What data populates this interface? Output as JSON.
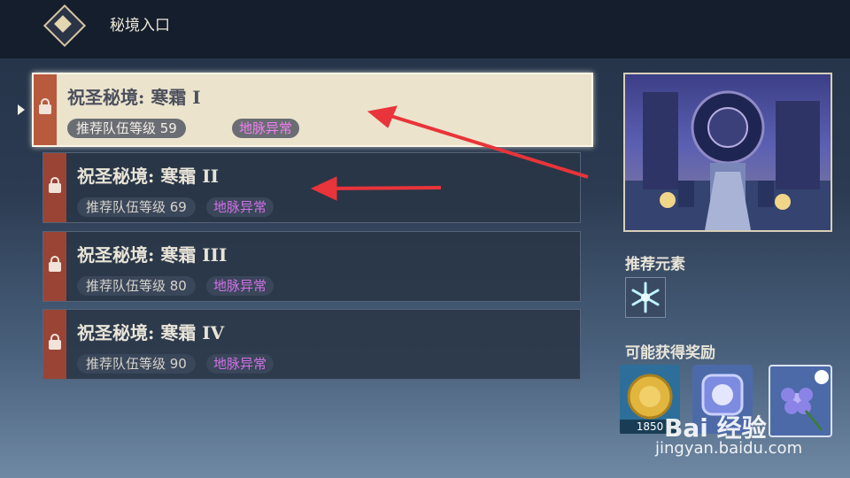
{
  "header": {
    "title": "秘境入口"
  },
  "domains": [
    {
      "name": "祝圣秘境: 寒霜 I",
      "level": "推荐队伍等级 59",
      "tag": "地脉异常",
      "selected": true
    },
    {
      "name": "祝圣秘境: 寒霜 II",
      "level": "推荐队伍等级 69",
      "tag": "地脉异常",
      "selected": false
    },
    {
      "name": "祝圣秘境: 寒霜 III",
      "level": "推荐队伍等级 80",
      "tag": "地脉异常",
      "selected": false
    },
    {
      "name": "祝圣秘境: 寒霜 IV",
      "level": "推荐队伍等级 90",
      "tag": "地脉异常",
      "selected": false
    }
  ],
  "sidebar": {
    "recommended_label": "推荐元素",
    "recommended_element_icon": "cryo-element-icon",
    "rewards_label": "可能获得奖励",
    "rewards": [
      {
        "icon": "mora-icon",
        "count": "1850"
      },
      {
        "icon": "artifact-exp-icon",
        "count": ""
      },
      {
        "icon": "flower-artifact-icon",
        "count": ""
      }
    ]
  },
  "watermark": {
    "brand": "Bai 经验",
    "url": "jingyan.baidu.com"
  },
  "colors": {
    "accent_red": "#e8343a",
    "tag_purple": "#d071e8",
    "lock_red": "#b85a3e"
  }
}
